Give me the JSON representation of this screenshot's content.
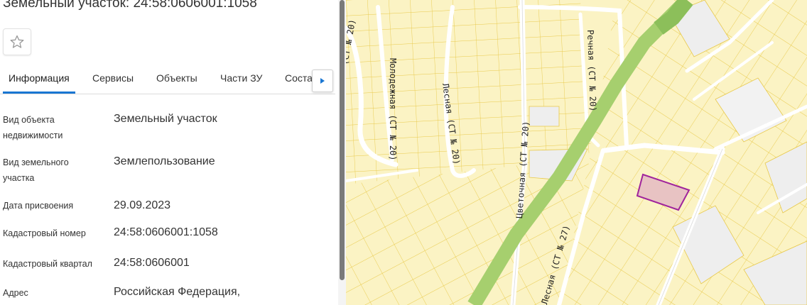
{
  "panel": {
    "title": "Земельный участок: 24:58:0606001:1058",
    "tabs": [
      "Информация",
      "Сервисы",
      "Объекты",
      "Части ЗУ",
      "Соста"
    ],
    "active_tab": "Информация",
    "fields": [
      {
        "label": "Вид объекта недвижимости",
        "value": "Земельный участок"
      },
      {
        "label": "Вид земельного участка",
        "value": "Землепользование"
      },
      {
        "label": "Дата присвоения",
        "value": "29.09.2023"
      },
      {
        "label": "Кадастровый номер",
        "value": "24:58:0606001:1058"
      },
      {
        "label": "Кадастровый квартал",
        "value": "24:58:0606001"
      },
      {
        "label": "Адрес",
        "value": "Российская Федерация,"
      }
    ],
    "icons": {
      "favorite": "star-outline-icon",
      "next": "chevron-right-icon"
    },
    "accent_color": "#1976d2"
  },
  "map": {
    "streets": [
      "(СТ № 20)",
      "Молодежная (СТ № 20)",
      "Лесная (СТ № 20)",
      "Цветочная (СТ № 20)",
      "Речная (СТ № 20)",
      "Лесная (СТ № 27)"
    ],
    "colors": {
      "parcel_fill": "#fbf3c4",
      "parcel_border": "#e8c94a",
      "road": "#ffffff",
      "forest_strip": "#a6cf6e",
      "selected_fill": "#e8c3c3",
      "selected_border": "#a0249c"
    }
  }
}
